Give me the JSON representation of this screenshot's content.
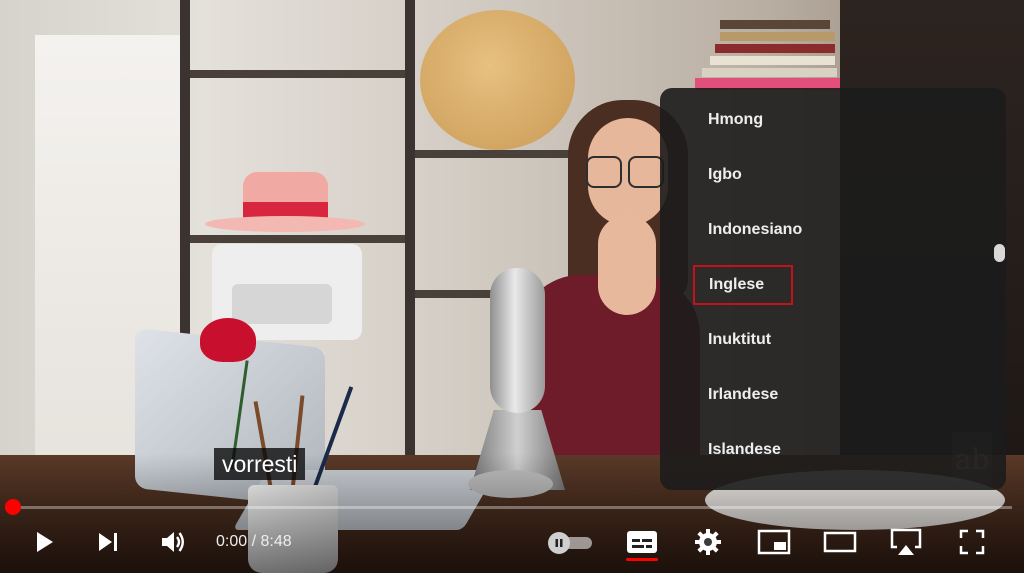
{
  "caption": {
    "text": "vorresti"
  },
  "subtitle_menu": {
    "items": [
      {
        "label": "Hmong",
        "selected": false
      },
      {
        "label": "Igbo",
        "selected": false
      },
      {
        "label": "Indonesiano",
        "selected": false
      },
      {
        "label": "Inglese",
        "selected": true
      },
      {
        "label": "Inuktitut",
        "selected": false
      },
      {
        "label": "Irlandese",
        "selected": false
      },
      {
        "label": "Islandese",
        "selected": false
      }
    ],
    "highlight_color": "#c4121a"
  },
  "player": {
    "time": {
      "current": "0:00",
      "separator": " / ",
      "duration": "8:48"
    },
    "progress_fraction": 0.0,
    "progress_color": "#ff0000",
    "autoplay_on": false,
    "controls": [
      {
        "name": "play-button",
        "icon": "play-icon"
      },
      {
        "name": "next-button",
        "icon": "skip-next-icon"
      },
      {
        "name": "volume-button",
        "icon": "volume-icon"
      },
      {
        "name": "subtitles-button",
        "icon": "subtitles-icon",
        "active": true
      },
      {
        "name": "settings-button",
        "icon": "gear-icon"
      },
      {
        "name": "miniplayer-button",
        "icon": "miniplayer-icon"
      },
      {
        "name": "theater-button",
        "icon": "theater-mode-icon"
      },
      {
        "name": "cast-button",
        "icon": "airplay-icon"
      },
      {
        "name": "fullscreen-button",
        "icon": "fullscreen-icon"
      }
    ]
  },
  "watermark": {
    "logo_text": "ab"
  }
}
